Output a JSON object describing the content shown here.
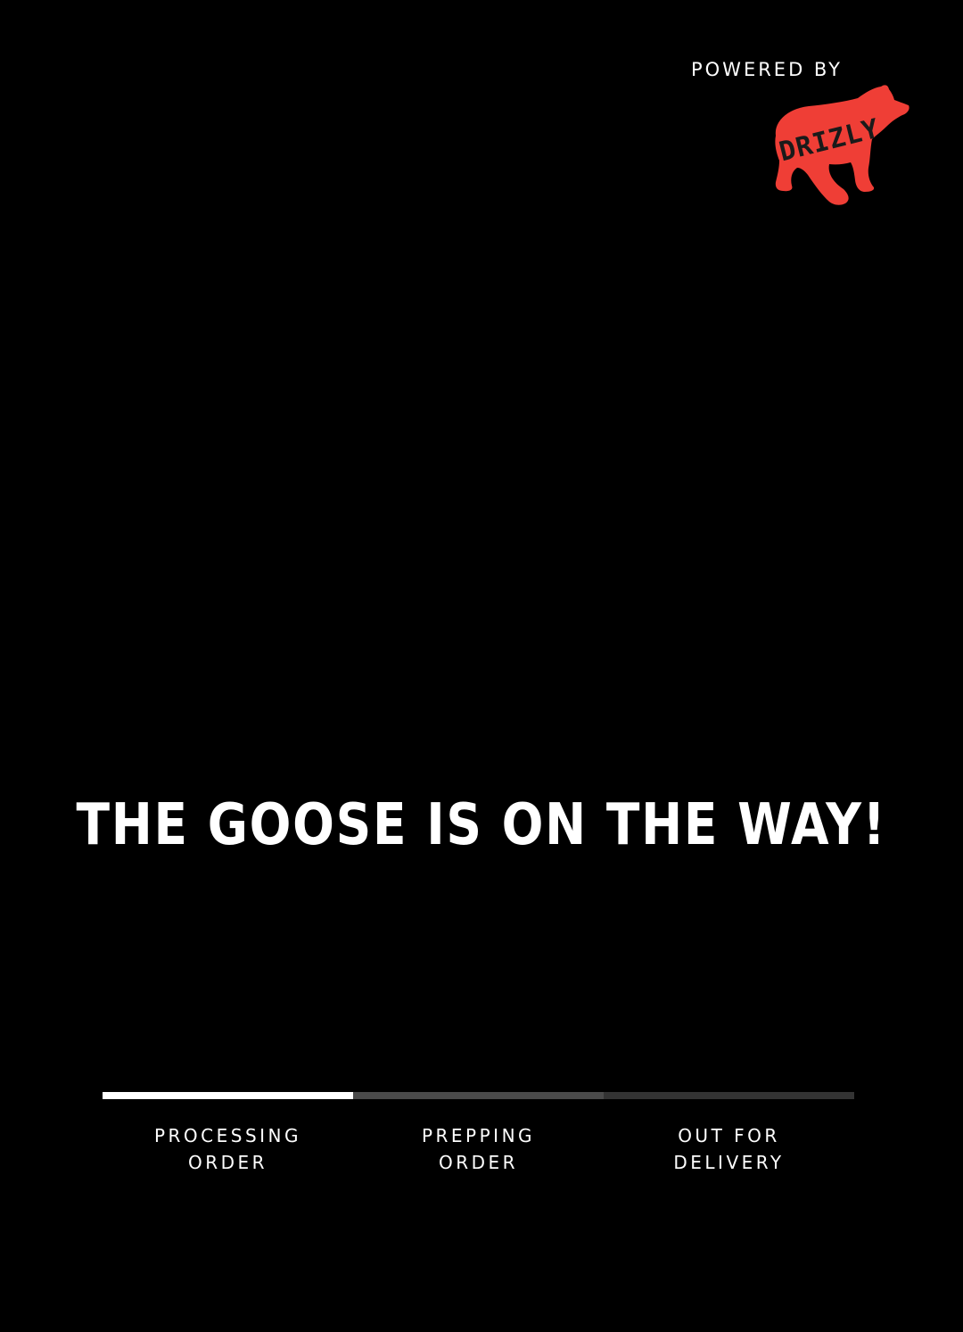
{
  "branding": {
    "powered_by": "POWERED BY",
    "logo_text": "DRIZLY",
    "logo_color": "#ef3e36",
    "logo_icon": "bear-icon"
  },
  "headline": "THE GOOSE IS ON THE WAY!",
  "progress": {
    "current_step": 1,
    "total_steps": 3,
    "active_color": "#ffffff",
    "inactive_colors": [
      "#4a4a4a",
      "#333333"
    ],
    "steps": [
      {
        "line1": "PROCESSING",
        "line2": "ORDER"
      },
      {
        "line1": "PREPPING",
        "line2": "ORDER"
      },
      {
        "line1": "OUT FOR",
        "line2": "DELIVERY"
      }
    ]
  }
}
